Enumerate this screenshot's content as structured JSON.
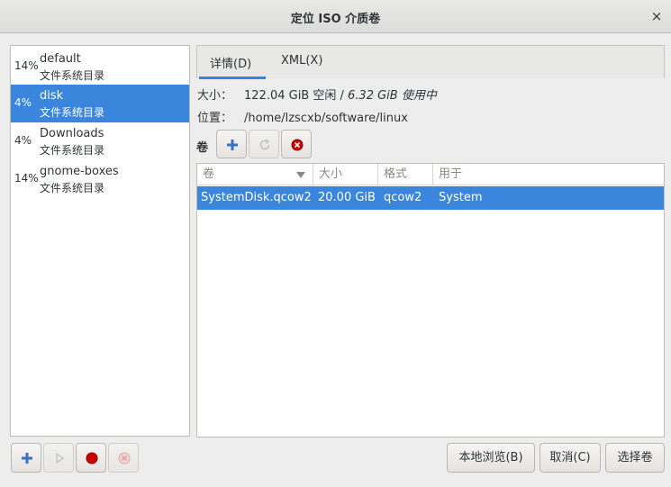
{
  "window": {
    "title": "定位 ISO 介质卷",
    "close_glyph": "×"
  },
  "pools": [
    {
      "percent": "14%",
      "name": "default",
      "type": "文件系统目录",
      "selected": false
    },
    {
      "percent": "4%",
      "name": "disk",
      "type": "文件系统目录",
      "selected": true
    },
    {
      "percent": "4%",
      "name": "Downloads",
      "type": "文件系统目录",
      "selected": false
    },
    {
      "percent": "14%",
      "name": "gnome-boxes",
      "type": "文件系统目录",
      "selected": false
    }
  ],
  "pool_buttons": {
    "add_icon": "plus-icon",
    "start_icon": "play-icon",
    "stop_icon": "record-icon",
    "delete_icon": "delete-icon"
  },
  "tabs": [
    {
      "label": "详情(D)",
      "active": true
    },
    {
      "label": "XML(X)",
      "active": false
    }
  ],
  "details": {
    "size_label": "大小：",
    "size_free": "122.04 GiB 空闲",
    "size_sep": " / ",
    "size_used": "6.32 GiB 使用中",
    "location_label": "位置：",
    "location_value": "/home/lzscxb/software/linux"
  },
  "volumes_label": "卷",
  "volume_table": {
    "columns": [
      "卷",
      "大小",
      "格式",
      "用于"
    ],
    "rows": [
      {
        "name": "SystemDisk.qcow2",
        "size": "20.00 GiB",
        "format": "qcow2",
        "used_by": "System",
        "selected": true
      }
    ]
  },
  "buttons": {
    "browse_local": "本地浏览(B)",
    "cancel": "取消(C)",
    "choose_volume": "选择卷"
  },
  "colors": {
    "selection": "#3b86dd",
    "accent_underline": "#3584e4",
    "add_icon": "#3b6fc1",
    "stop_red": "#cc0000"
  }
}
